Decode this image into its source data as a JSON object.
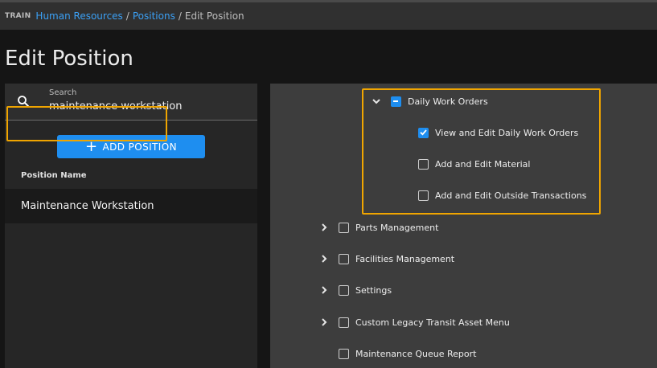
{
  "breadcrumb": {
    "env": "TRAIN",
    "items": [
      "Human Resources",
      "Positions"
    ],
    "separator": "/",
    "current": "Edit Position"
  },
  "page": {
    "title": "Edit Position"
  },
  "search": {
    "label": "Search",
    "value": "maintenance workstation"
  },
  "add_button": {
    "label": "ADD POSITION"
  },
  "positions": {
    "column_header": "Position Name",
    "rows": [
      {
        "name": "Maintenance Workstation"
      }
    ]
  },
  "permissions": {
    "group": {
      "label": "Daily Work Orders",
      "state": "partial",
      "expanded": true,
      "children": [
        {
          "label": "View and Edit Daily Work Orders",
          "checked": true
        },
        {
          "label": "Add and Edit Material",
          "checked": false
        },
        {
          "label": "Add and Edit Outside Transactions",
          "checked": false
        }
      ]
    },
    "others": [
      {
        "label": "Parts Management",
        "checked": false,
        "expandable": true
      },
      {
        "label": "Facilities Management",
        "checked": false,
        "expandable": true
      },
      {
        "label": "Settings",
        "checked": false,
        "expandable": true
      },
      {
        "label": "Custom Legacy Transit Asset Menu",
        "checked": false,
        "expandable": true
      },
      {
        "label": "Maintenance Queue Report",
        "checked": false,
        "expandable": false
      }
    ]
  },
  "colors": {
    "accent": "#1e8ef0",
    "highlight": "#f0a500",
    "link": "#3ba0f5"
  }
}
